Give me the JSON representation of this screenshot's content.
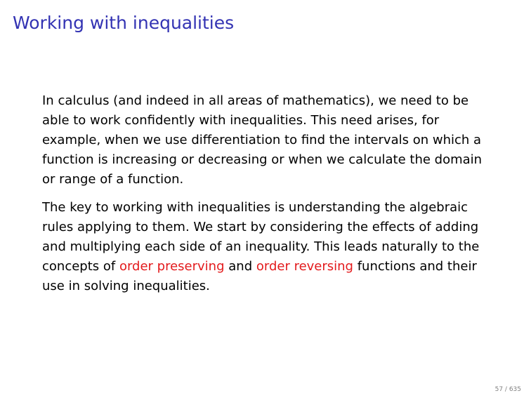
{
  "slide": {
    "title": "Working with inequalities",
    "paragraph1": "In calculus (and indeed in all areas of mathematics), we need to be able to work confidently with inequalities. This need arises, for example, when we use differentiation to find the intervals on which a function is increasing or decreasing or when we calculate the domain or range of a function.",
    "paragraph2": {
      "text_before": "The key to working with inequalities is understanding the algebraic rules applying to them. We start by considering the effects of adding and multiplying each side of an inequality. This leads naturally to the concepts of ",
      "term1": "order preserving",
      "text_middle": " and ",
      "term2": "order reversing",
      "text_after": " functions and their use in solving inequalities."
    },
    "page_number": "57 / 635"
  },
  "colors": {
    "title": "#3333b3",
    "highlight": "#e31a1c",
    "body_text": "#000000",
    "page_number": "#808080"
  }
}
